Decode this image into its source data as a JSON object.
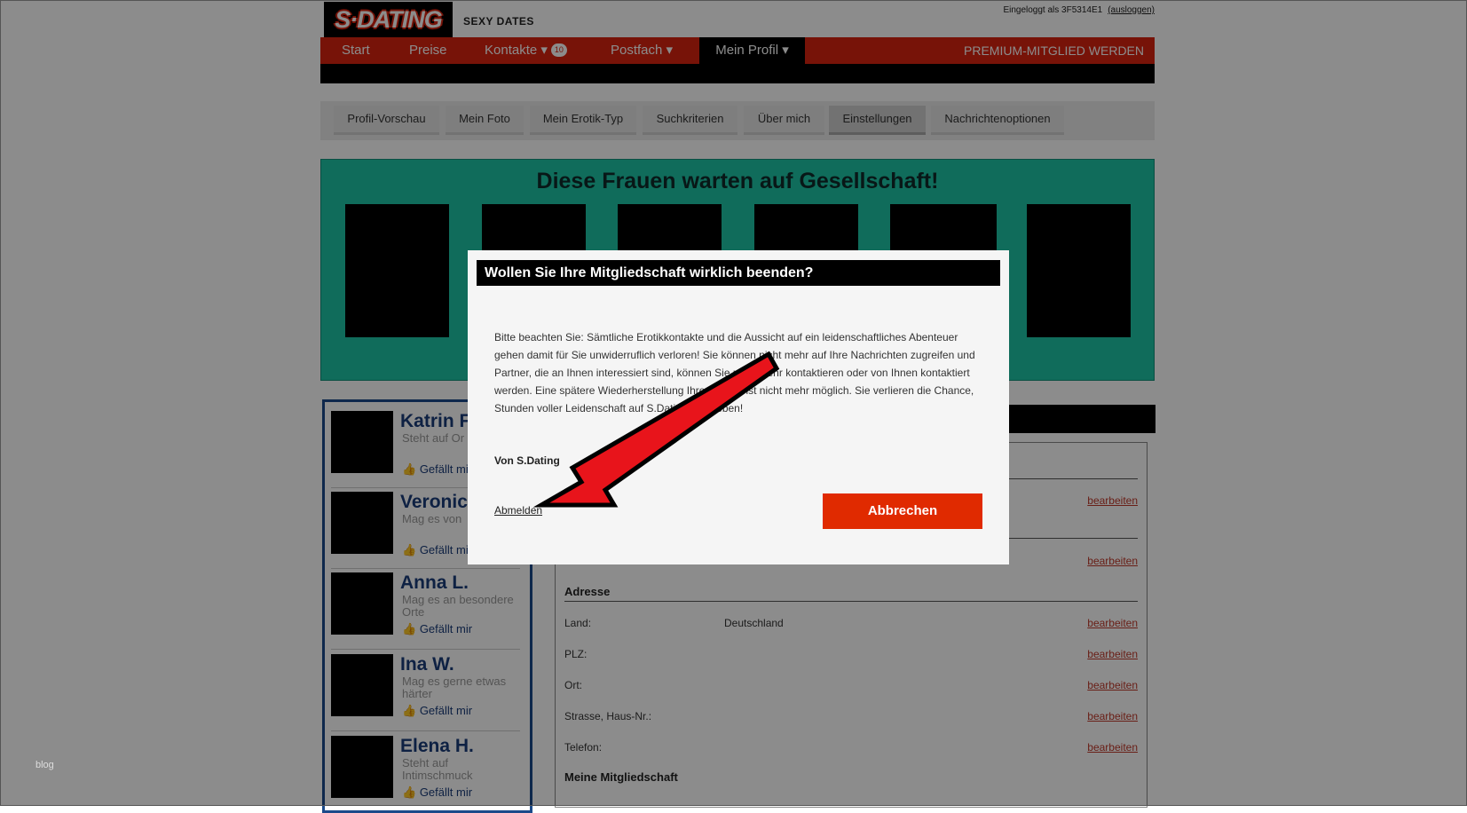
{
  "header": {
    "logo_text": "S·DATING",
    "tagline": "SEXY DATES",
    "login_text": "Eingeloggt als 3F5314E1",
    "logout_link": "(ausloggen)"
  },
  "nav": {
    "items": [
      {
        "label": "Start"
      },
      {
        "label": "Preise"
      },
      {
        "label": "Kontakte ▾",
        "badge": "10"
      },
      {
        "label": "Postfach ▾"
      },
      {
        "label": "Mein Profil ▾"
      }
    ],
    "premium": "PREMIUM-MITGLIED WERDEN"
  },
  "subtabs": [
    "Profil-Vorschau",
    "Mein Foto",
    "Mein Erotik-Typ",
    "Suchkriterien",
    "Über mich",
    "Einstellungen",
    "Nachrichtenoptionen"
  ],
  "banner": {
    "title": "Diese Frauen warten auf Gesellschaft!"
  },
  "sidebar": {
    "like_label": "Gefällt mir",
    "items": [
      {
        "name": "Katrin F.",
        "text": "Steht auf Or"
      },
      {
        "name": "Veronica",
        "text": "Mag es von"
      },
      {
        "name": "Anna L.",
        "text": "Mag es an besondere Orte"
      },
      {
        "name": "Ina W.",
        "text": "Mag es gerne etwas härter"
      },
      {
        "name": "Elena H.",
        "text": "Steht auf Intimschmuck"
      }
    ]
  },
  "settings": {
    "edit_label": "bearbeiten",
    "address_heading": "Adresse",
    "membership_heading": "Meine Mitgliedschaft",
    "rows": [
      {
        "label": "Land:",
        "value": "Deutschland"
      },
      {
        "label": "PLZ:",
        "value": ""
      },
      {
        "label": "Ort:",
        "value": ""
      },
      {
        "label": "Strasse, Haus-Nr.:",
        "value": ""
      },
      {
        "label": "Telefon:",
        "value": ""
      }
    ]
  },
  "modal": {
    "title": "Wollen Sie Ihre Mitgliedschaft wirklich beenden?",
    "body": "Bitte beachten Sie: Sämtliche Erotikkontakte und die Aussicht auf ein leidenschaftliches Abenteuer gehen damit für Sie unwiderruflich verloren! Sie können nicht mehr auf Ihre Nachrichten zugreifen und Partner, die an Ihnen interessiert sind, können Sie nicht mehr kontaktieren oder von Ihnen kontaktiert werden. Eine spätere Wiederherstellung Ihres Profils ist nicht mehr möglich. Sie verlieren die Chance, Stunden voller Leidenschaft auf S.Dating zu erleben!",
    "signature": "Von S.Dating",
    "logout_link": "Abmelden",
    "cancel_button": "Abbrechen"
  },
  "watermark": "blog",
  "colors": {
    "brand_red": "#d9230f",
    "banner_green": "#1ec5a6",
    "cancel_red": "#e02a00",
    "arrow_red": "#e8141b"
  }
}
